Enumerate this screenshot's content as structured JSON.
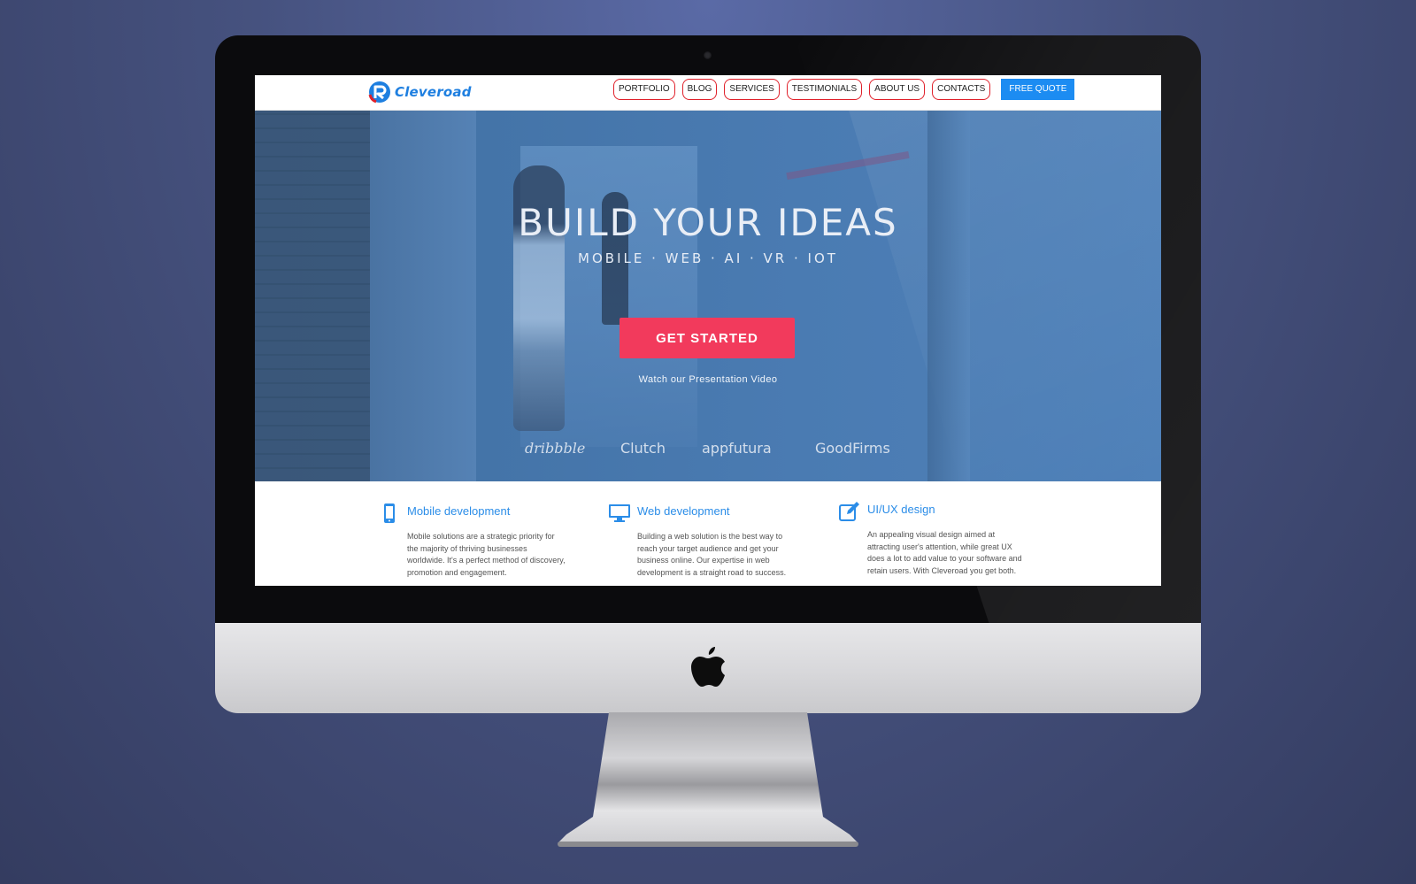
{
  "colors": {
    "brand_blue": "#1e7fe0",
    "nav_border": "#e0202a",
    "quote_button": "#1c8cf2",
    "cta_button": "#f23a5c",
    "hero_overlay": "#4a7bb2",
    "service_title": "#2b8de8"
  },
  "header": {
    "logo_text": "Cleveroad",
    "nav": [
      "PORTFOLIO",
      "BLOG",
      "SERVICES",
      "TESTIMONIALS",
      "ABOUT US",
      "CONTACTS"
    ],
    "free_quote": "FREE QUOTE"
  },
  "hero": {
    "title": "BUILD YOUR IDEAS",
    "subtitle": "MOBILE · WEB · AI · VR · IOT",
    "cta_label": "GET STARTED",
    "video_link": "Watch our Presentation Video",
    "partners": [
      "dribbble",
      "Clutch",
      "appfutura",
      "GoodFirms"
    ]
  },
  "services": [
    {
      "icon": "mobile-phone-icon",
      "title": "Mobile development",
      "description": "Mobile solutions are a strategic priority for the majority of thriving businesses worldwide. It's a perfect method of discovery, promotion and engagement."
    },
    {
      "icon": "monitor-icon",
      "title": "Web development",
      "description": "Building a web solution is the best way to reach your target audience and get your business online. Our expertise in web development is a straight road to success."
    },
    {
      "icon": "edit-pencil-icon",
      "title": "UI/UX design",
      "description": "An appealing visual design aimed at attracting user's attention, while great UX does a lot to add value to your software and retain users. With Cleveroad you get both."
    }
  ]
}
